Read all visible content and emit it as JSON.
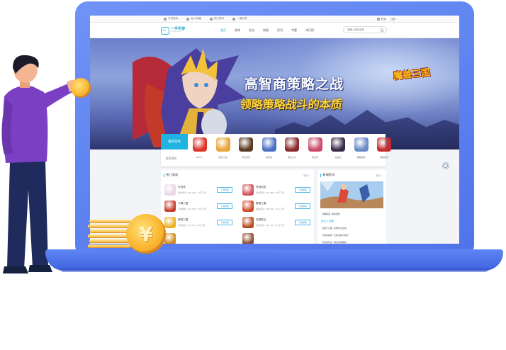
{
  "topbar": {
    "links": [
      "手机游戏",
      "加入收藏",
      "热门游戏",
      "一键分享"
    ],
    "right_links": [
      "登录",
      "注册"
    ]
  },
  "header": {
    "logo_name": "一手手游",
    "logo_sub": "1shou.com",
    "nav": [
      "首页",
      "游戏",
      "礼包",
      "热搜",
      "资讯",
      "专题",
      "排行榜"
    ],
    "active_nav_index": 0,
    "search_placeholder": "请输入游戏名称"
  },
  "banner": {
    "title": "高智商策略之战",
    "subtitle": "领略策略战斗的本质",
    "logo_text": "魔兽三国",
    "dot_count": 9,
    "active_dot": 1
  },
  "game_strip": {
    "tag_label": "最新游戏",
    "section_label": "推荐游戏",
    "games": [
      {
        "name": "NUVT...",
        "color": "#d9342b"
      },
      {
        "name": "魔兽三国",
        "color": "#e8a43a"
      },
      {
        "name": "寻龙传奇",
        "color": "#5a3a22"
      },
      {
        "name": "叙利亚",
        "color": "#4a6fc2"
      },
      {
        "name": "暗影之刃",
        "color": "#8a2a2a"
      },
      {
        "name": "修仙录",
        "color": "#c94a6a"
      },
      {
        "name": "仙侠记",
        "color": "#3a2a4a"
      },
      {
        "name": "神雕侠侣",
        "color": "#6a8ac8"
      },
      {
        "name": "神魔封印",
        "color": "#c22b2b"
      }
    ]
  },
  "hot_games": {
    "title": "热门游戏",
    "more_label": "更多 >",
    "download_label": "下载游戏",
    "items": [
      {
        "name": "天剑诀",
        "meta": "角色扮演 | 345.2M | 1.2万下载",
        "color": "#e9d6e4"
      },
      {
        "name": "苍穹剑说",
        "meta": "动作冒险 | 256.8M | 8.6万下载",
        "color": "#d0505a"
      },
      {
        "name": "卡牌三国",
        "meta": "卡牌策略 | 212.5M | 3.3万下载",
        "color": "#c43a2a"
      },
      {
        "name": "赛城三国",
        "meta": "策略经营 | 198.2M | 5.1万下载",
        "color": "#d04a2a"
      },
      {
        "name": "放鸭三国",
        "meta": "休闲益智 | 87.4M | 2.4万下载",
        "color": "#e9b020"
      },
      {
        "name": "花城风云",
        "meta": "角色扮演 | 305.1M | 6.7万下载",
        "color": "#b84a1a"
      },
      {
        "name": "",
        "meta": "",
        "color": "#d08a1a"
      },
      {
        "name": "",
        "meta": "",
        "color": "#8a4a2a"
      }
    ]
  },
  "news": {
    "title": "新闻资讯",
    "more_label": "更多 >",
    "items": [
      "【策略战】版本更新",
      "新手入门攻略",
      "【魔兽三国】新服开启活动",
      "《剑侠情缘》全新资料片曝光",
      "【花城风云】神兵系统解析",
      "《天剑诀》跨服战即将开启"
    ],
    "highlight_index": 1
  },
  "coins": {
    "symbol": "¥"
  },
  "colors": {
    "laptop": "#5b7ff0",
    "accent": "#1fb4e0",
    "gold": "#f9b52f",
    "shirt": "#7b3fc4",
    "pants": "#1e2b5c"
  }
}
